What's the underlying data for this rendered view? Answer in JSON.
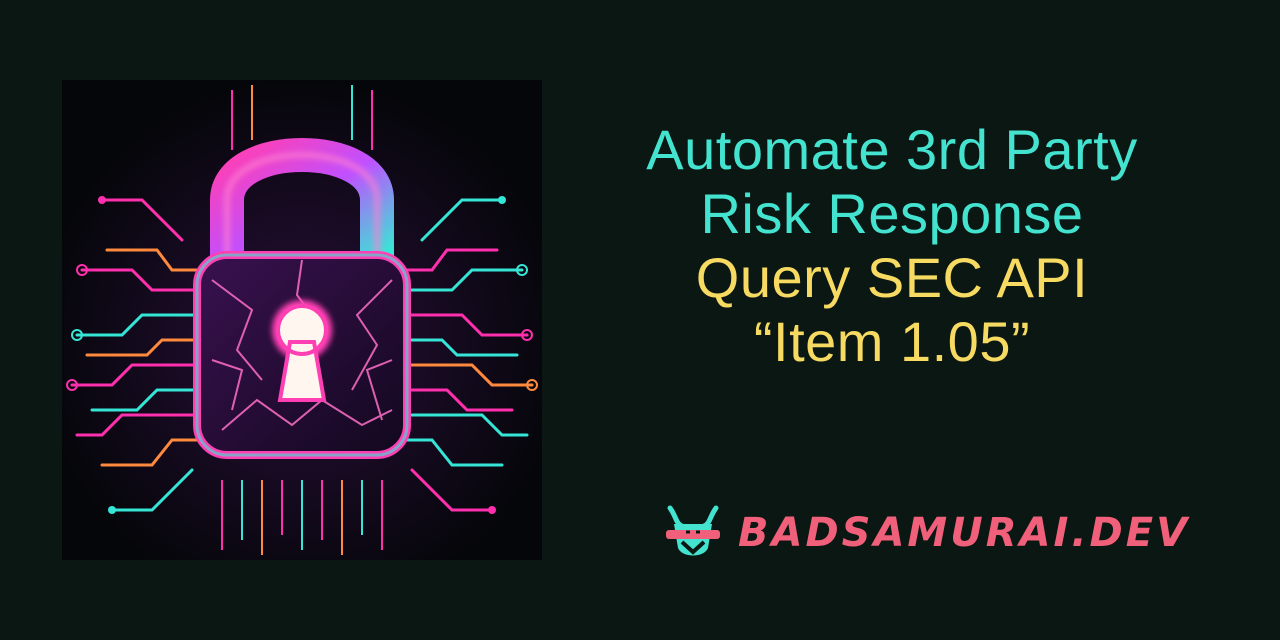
{
  "headline": {
    "line1": "Automate 3rd Party",
    "line2": "Risk Response",
    "line3": "Query SEC API",
    "line4": "“Item 1.05”"
  },
  "brand": {
    "text": "BADSAMURAI.DEV",
    "logo_icon": "samurai-mask-icon"
  },
  "art": {
    "icon": "padlock-icon",
    "description_colors": {
      "pink": "#ff2fae",
      "cyan": "#35e6d6",
      "orange": "#ff8a3d"
    }
  },
  "colors": {
    "background": "#0b1712",
    "headline_primary": "#43e3d0",
    "headline_secondary": "#f6da62",
    "brand": "#f0607a"
  }
}
